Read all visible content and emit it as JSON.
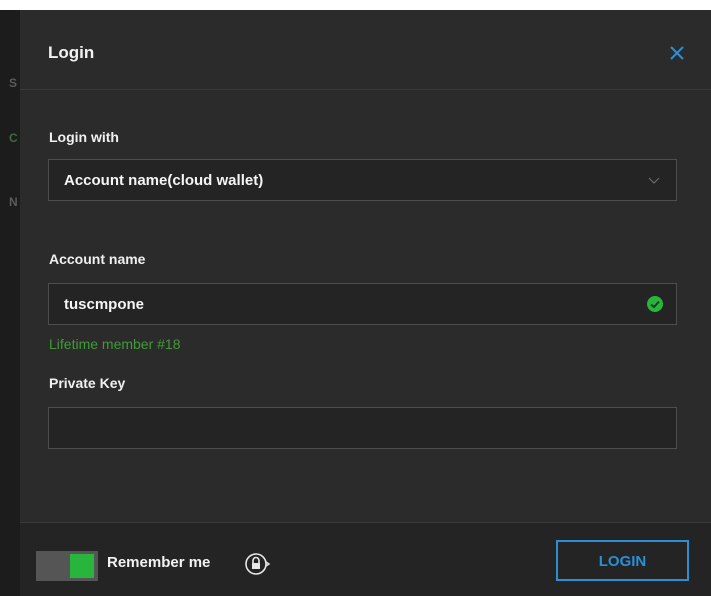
{
  "dialog": {
    "title": "Login",
    "close_icon": "close-icon"
  },
  "login_with": {
    "label": "Login with",
    "selected": "Account name(cloud wallet)",
    "chevron_icon": "chevron-down-icon"
  },
  "account_name": {
    "label": "Account name",
    "value": "tuscmpone",
    "status_icon": "check-circle-icon",
    "hint": "Lifetime member #18"
  },
  "private_key": {
    "label": "Private Key",
    "value": ""
  },
  "footer": {
    "remember_label": "Remember me",
    "remember_enabled": true,
    "lock_icon": "lock-icon",
    "login_label": "LOGIN"
  },
  "colors": {
    "accent": "#2a8fd4",
    "success": "#27b53c",
    "hint_text": "#3f9c35",
    "panel": "#2b2b2b"
  }
}
